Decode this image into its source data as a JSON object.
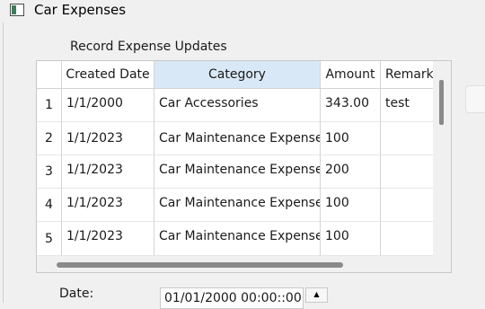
{
  "window": {
    "title": "Car Expenses",
    "icon": "app-window-icon"
  },
  "section": {
    "label": "Record Expense Updates"
  },
  "table": {
    "columns": [
      "Created Date",
      "Category",
      "Amount",
      "Remark"
    ],
    "selected_column": "Category",
    "rows": [
      {
        "num": "1",
        "created": "1/1/2000",
        "category": "Car Accessories",
        "amount": "343.00",
        "remark": "test"
      },
      {
        "num": "2",
        "created": "1/1/2023",
        "category": "Car Maintenance Expenses",
        "amount": "100",
        "remark": ""
      },
      {
        "num": "3",
        "created": "1/1/2023",
        "category": "Car Maintenance Expenses",
        "amount": "200",
        "remark": ""
      },
      {
        "num": "4",
        "created": "1/1/2023",
        "category": "Car Maintenance Expenses",
        "amount": "100",
        "remark": ""
      },
      {
        "num": "5",
        "created": "1/1/2023",
        "category": "Car Maintenance Expenses",
        "amount": "100",
        "remark": ""
      }
    ]
  },
  "date": {
    "label": "Date:",
    "value": "01/01/2000 00:00::00",
    "spin_up": "▲"
  },
  "colors": {
    "selected_header": "#d9e8f6",
    "background": "#f0f0f0"
  }
}
